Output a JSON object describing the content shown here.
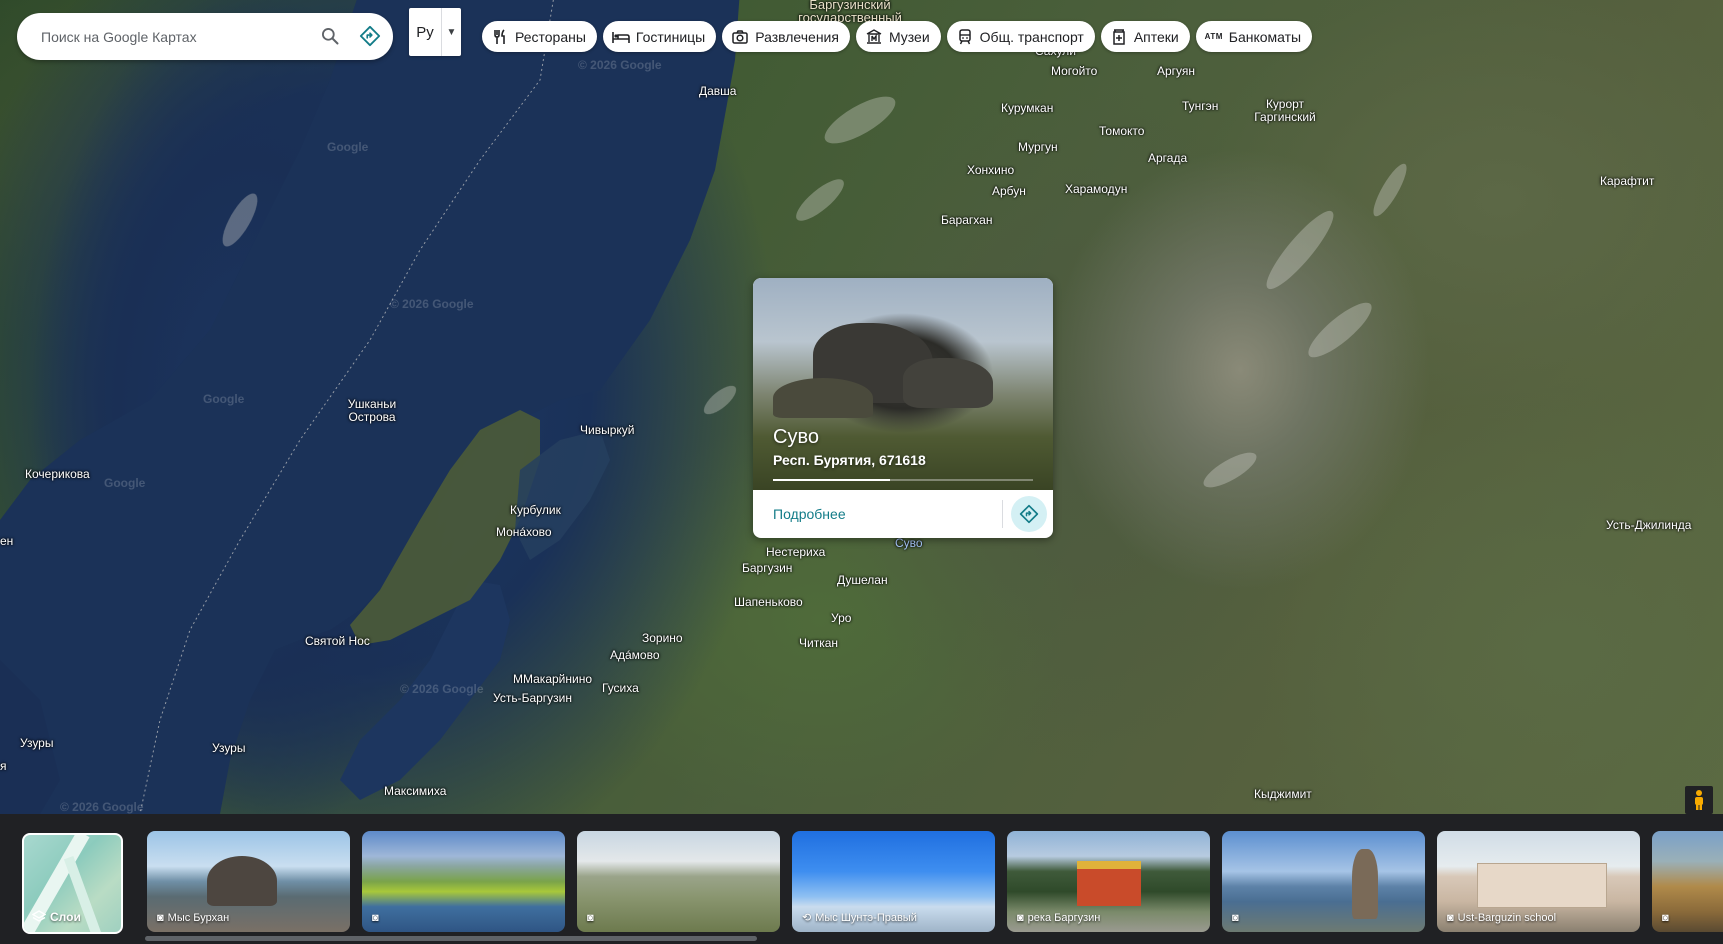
{
  "search": {
    "placeholder": "Поиск на Google Картах"
  },
  "language": {
    "label": "Ру"
  },
  "chips": [
    {
      "label": "Рестораны",
      "icon": "fork-knife-icon"
    },
    {
      "label": "Гостиницы",
      "icon": "bed-icon"
    },
    {
      "label": "Развлечения",
      "icon": "camera-icon"
    },
    {
      "label": "Музеи",
      "icon": "museum-icon"
    },
    {
      "label": "Общ. транспорт",
      "icon": "train-icon"
    },
    {
      "label": "Аптеки",
      "icon": "pharmacy-icon"
    },
    {
      "label": "Банкоматы",
      "icon": "atm-icon"
    }
  ],
  "place_card": {
    "title": "Суво",
    "subtitle": "Респ. Бурятия, 671618",
    "details_label": "Подробнее",
    "photo_progress": 0.45
  },
  "map": {
    "labels": [
      "Баргузинский государственный",
      "Давша",
      "Могойто",
      "Аргуян",
      "Курумкан",
      "Тунгэн",
      "Курорт Гаргинский",
      "Томокто",
      "Мургун",
      "Аргада",
      "Хонхино",
      "Арбун",
      "Харамодун",
      "Карафтит",
      "Барагхан",
      "Ушканьи Острова",
      "Чивыркуй",
      "Кочерикова",
      "Курбулик",
      "Монáхово",
      "Нестериха",
      "Баргузин",
      "Душелан",
      "Шапеньково",
      "Уро",
      "Читкан",
      "Зорино",
      "Адáмово",
      "Святой Нос",
      "ММакарйнино",
      "Гусиха",
      "Усть-Баргузин",
      "Узуры",
      "Узуры",
      "Максимиха",
      "Кыджимит",
      "Усть-Джилинда",
      "Суво",
      "Сахули",
      "ен",
      "я"
    ],
    "watermark": "© 2026 Google",
    "watermark_short": "Google"
  },
  "layers": {
    "label": "Слои"
  },
  "photos": [
    {
      "label": "Мыс Бурхан",
      "icon": "camera-icon"
    },
    {
      "label": "",
      "icon": "camera-icon"
    },
    {
      "label": "",
      "icon": "camera-icon"
    },
    {
      "label": "Мыс Шунтэ-Правый",
      "icon": "360-icon"
    },
    {
      "label": "река Баргузин",
      "icon": "camera-icon"
    },
    {
      "label": "",
      "icon": "camera-icon"
    },
    {
      "label": "Ust-Barguzin school",
      "icon": "camera-icon"
    },
    {
      "label": "",
      "icon": "camera-icon"
    }
  ]
}
